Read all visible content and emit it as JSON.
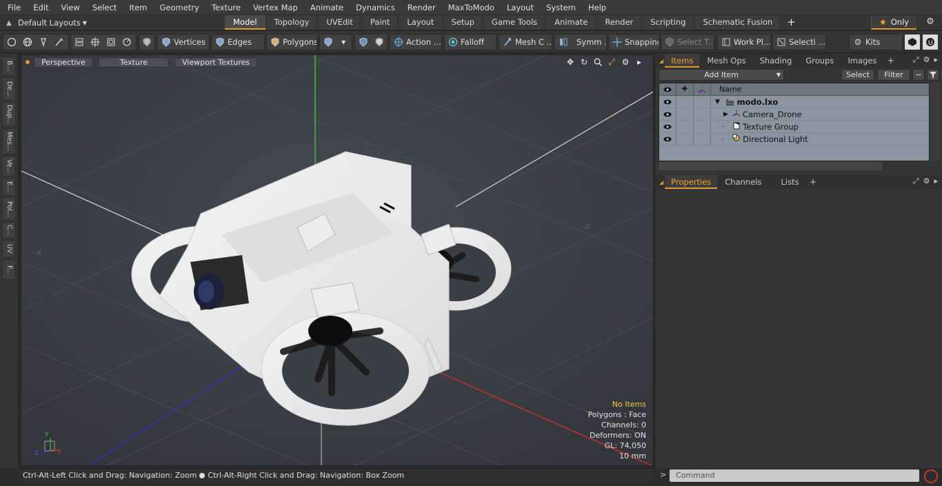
{
  "menu": [
    "File",
    "Edit",
    "View",
    "Select",
    "Item",
    "Geometry",
    "Texture",
    "Vertex Map",
    "Animate",
    "Dynamics",
    "Render",
    "MaxToModo",
    "Layout",
    "System",
    "Help"
  ],
  "layout_selector": {
    "label": "Default Layouts"
  },
  "mode_tabs": [
    {
      "label": "Model",
      "active": true
    },
    {
      "label": "Topology"
    },
    {
      "label": "UVEdit"
    },
    {
      "label": "Paint"
    },
    {
      "label": "Layout"
    },
    {
      "label": "Setup"
    },
    {
      "label": "Game Tools"
    },
    {
      "label": "Animate"
    },
    {
      "label": "Render"
    },
    {
      "label": "Scripting"
    },
    {
      "label": "Schematic Fusion"
    }
  ],
  "only_label": "Only",
  "toolbar": {
    "vertices": "Vertices",
    "edges": "Edges",
    "polygons": "Polygons",
    "action": "Action ...",
    "falloff": "Falloff",
    "mesh": "Mesh C ...",
    "symm": "Symm ...",
    "snapping": "Snapping",
    "select_t": "Select T...",
    "work_pl": "Work Pl...",
    "selecti": "Selecti ...",
    "kits": "Kits"
  },
  "left_strip": [
    "B...",
    "De...",
    "Dup...",
    "Mes...",
    "Ve...",
    "E...",
    "Pol...",
    "C...",
    "UV",
    "F..."
  ],
  "viewport": {
    "buttons": [
      "Perspective",
      "Texture",
      "Viewport Textures"
    ],
    "info": {
      "selection": "No Items",
      "polygons": "Polygons : Face",
      "channels": "Channels: 0",
      "deformers": "Deformers: ON",
      "gl": "GL: 74,050",
      "scale": "10 mm"
    },
    "axis_labels": {
      "x": "X",
      "y": "Y",
      "z": "Z",
      "neg_x": "-X",
      "neg_z": "-Z"
    }
  },
  "status_bar": {
    "left": "Ctrl-Alt-Left Click and Drag: Navigation: Zoom",
    "right": "Ctrl-Alt-Right Click and Drag: Navigation: Box Zoom"
  },
  "items_panel": {
    "tabs": [
      {
        "label": "Items",
        "active": true
      },
      {
        "label": "Mesh Ops"
      },
      {
        "label": "Shading"
      },
      {
        "label": "Groups"
      },
      {
        "label": "Images"
      }
    ],
    "add_item": "Add Item",
    "select": "Select",
    "filter": "Filter",
    "column_name": "Name",
    "tree": [
      {
        "label": "modo.lxo",
        "bold": true
      },
      {
        "label": "Camera_Drone"
      },
      {
        "label": "Texture Group"
      },
      {
        "label": "Directional Light"
      }
    ]
  },
  "properties_panel": {
    "tabs": [
      {
        "label": "Properties",
        "active": true
      },
      {
        "label": "Channels"
      },
      {
        "label": "Lists"
      }
    ]
  },
  "command": {
    "placeholder": "Command",
    "prompt": ">"
  },
  "colors": {
    "accent": "#e39b30",
    "viewport_bg": "#3a3f44",
    "tree_bg": "#8b95a0"
  }
}
